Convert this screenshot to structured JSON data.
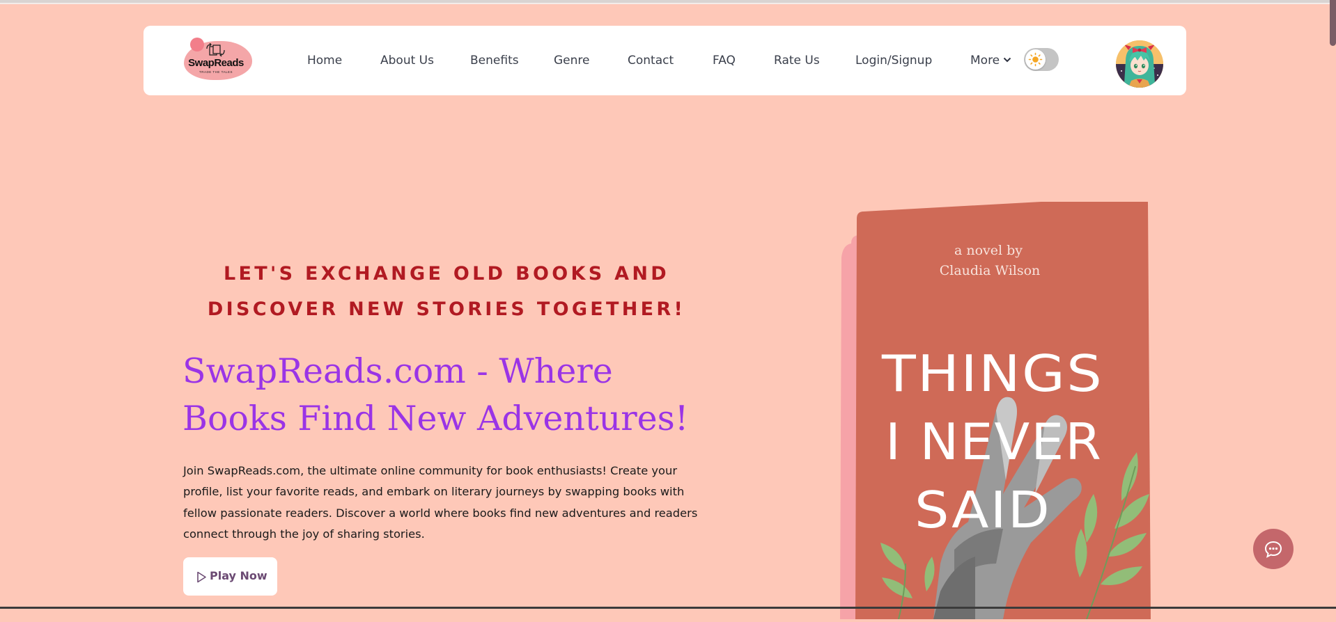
{
  "brand": {
    "name": "SwapReads",
    "tagline": "TRADE THE TALES"
  },
  "nav": {
    "items": [
      {
        "label": "Home"
      },
      {
        "label": "About Us"
      },
      {
        "label": "Benefits"
      },
      {
        "label": "Genre"
      },
      {
        "label": "Contact"
      },
      {
        "label": "FAQ"
      },
      {
        "label": "Rate Us"
      },
      {
        "label": "Login/Signup"
      }
    ],
    "more_label": "More"
  },
  "hero": {
    "eyebrow_line1": "LET'S EXCHANGE OLD BOOKS AND",
    "eyebrow_line2": "DISCOVER NEW STORIES TOGETHER!",
    "headline_line1": "SwapReads.com - Where",
    "headline_line2": "Books Find New Adventures!",
    "description": "Join SwapReads.com, the ultimate online community for book enthusiasts! Create your profile, list your favorite reads, and embark on literary journeys by swapping books with fellow passionate readers. Discover a world where books find new adventures and readers connect through the joy of sharing stories.",
    "cta_label": "Play Now"
  },
  "book": {
    "byline_1": "a novel by",
    "byline_2": "Claudia Wilson",
    "title_1": "THINGS",
    "title_2": "I NEVER",
    "title_3": "SAID"
  },
  "colors": {
    "page_bg": "#fec8b8",
    "eyebrow": "#b11a22",
    "headline": "#9a34e6",
    "book_cover": "#cf6a57",
    "book_spine": "#f6a3a8",
    "chat_button": "#c4676b"
  },
  "icons": {
    "theme_toggle": "sun-icon",
    "more_dropdown": "chevron-down-icon",
    "play": "play-icon",
    "chat": "chat-bubble-icon"
  }
}
